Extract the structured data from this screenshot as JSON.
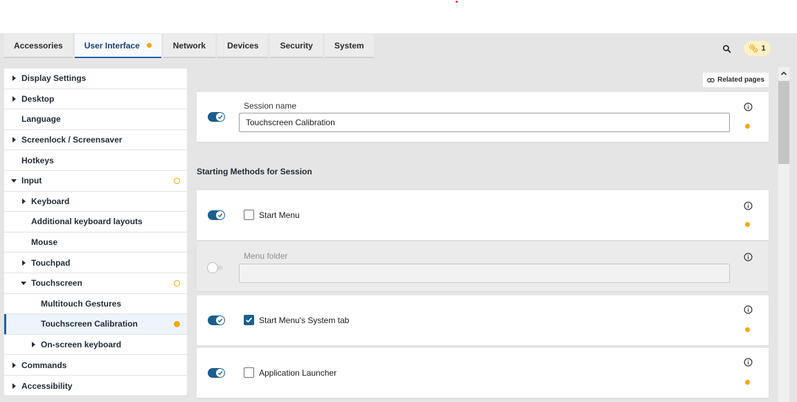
{
  "tabs": [
    {
      "label": "Accessories"
    },
    {
      "label": "User Interface"
    },
    {
      "label": "Network"
    },
    {
      "label": "Devices"
    },
    {
      "label": "Security"
    },
    {
      "label": "System"
    }
  ],
  "header": {
    "search_icon": "search-icon",
    "notification_icon": "gears-icon",
    "notification_count": "1"
  },
  "sidebar": {
    "items": [
      {
        "label": "Display Settings"
      },
      {
        "label": "Desktop"
      },
      {
        "label": "Language"
      },
      {
        "label": "Screenlock / Screensaver"
      },
      {
        "label": "Hotkeys"
      },
      {
        "label": "Input"
      },
      {
        "label": "Keyboard"
      },
      {
        "label": "Additional keyboard layouts"
      },
      {
        "label": "Mouse"
      },
      {
        "label": "Touchpad"
      },
      {
        "label": "Touchscreen"
      },
      {
        "label": "Multitouch Gestures"
      },
      {
        "label": "Touchscreen Calibration"
      },
      {
        "label": "On-screen keyboard"
      },
      {
        "label": "Commands"
      },
      {
        "label": "Accessibility"
      }
    ]
  },
  "main": {
    "related_pages": "Related pages",
    "session_name_label": "Session name",
    "session_name_value": "Touchscreen Calibration",
    "section_title": "Starting Methods for Session",
    "start_menu": "Start Menu",
    "menu_folder_label": "Menu folder",
    "menu_folder_value": "",
    "start_menu_system_tab": "Start Menu's System tab",
    "application_launcher": "Application Launcher"
  },
  "colors": {
    "accent": "#1b5f8f",
    "status_changed": "#f2a900",
    "active_tab_border": "#1b5fa8"
  }
}
